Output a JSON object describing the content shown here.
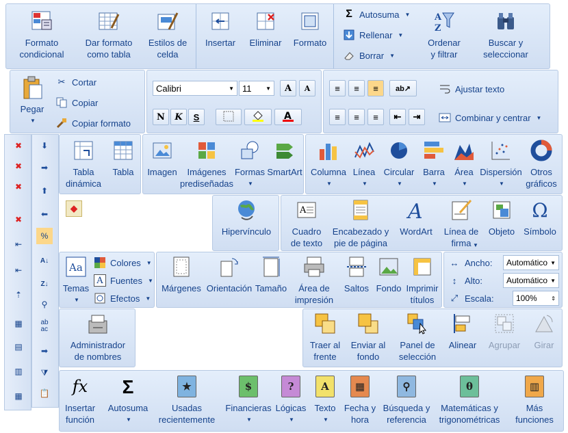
{
  "cells": {
    "formato_condicional": "Formato\ncondicional",
    "dar_formato_tabla": "Dar formato\ncomo tabla",
    "estilos_celda": "Estilos de\ncelda",
    "insertar": "Insertar",
    "eliminar": "Eliminar",
    "formato": "Formato",
    "autosuma": "Autosuma",
    "rellenar": "Rellenar",
    "borrar": "Borrar",
    "ordenar": "Ordenar\ny filtrar",
    "buscar": "Buscar y\nseleccionar"
  },
  "clipboard": {
    "pegar": "Pegar",
    "cortar": "Cortar",
    "copiar": "Copiar",
    "copiar_formato": "Copiar formato"
  },
  "font": {
    "name": "Calibri",
    "size": "11",
    "grow": "A",
    "shrink": "A",
    "bold": "N",
    "italic": "K",
    "underline": "S"
  },
  "alignment": {
    "ajustar_texto": "Ajustar texto",
    "combinar": "Combinar y centrar"
  },
  "insert_tables": {
    "tabla_dinamica": "Tabla\ndinámica",
    "tabla": "Tabla"
  },
  "insert_illustrations": {
    "imagen": "Imagen",
    "imagenes_predisenadas": "Imágenes\nprediseñadas",
    "formas": "Formas",
    "smartart": "SmartArt"
  },
  "charts": {
    "columna": "Columna",
    "linea": "Línea",
    "circular": "Circular",
    "barra": "Barra",
    "area": "Área",
    "dispersion": "Dispersión",
    "otros": "Otros\ngráficos"
  },
  "links": {
    "hipervinculo": "Hipervínculo"
  },
  "text_group": {
    "cuadro_texto": "Cuadro\nde texto",
    "encabezado": "Encabezado y\npie de página",
    "wordart": "WordArt",
    "linea_firma": "Línea de\nfirma",
    "objeto": "Objeto",
    "simbolo": "Símbolo"
  },
  "themes": {
    "temas": "Temas",
    "colores": "Colores",
    "fuentes": "Fuentes",
    "efectos": "Efectos"
  },
  "page_setup": {
    "margenes": "Márgenes",
    "orientacion": "Orientación",
    "tamano": "Tamaño",
    "area_impresion": "Área de\nimpresión",
    "saltos": "Saltos",
    "fondo": "Fondo",
    "imprimir_titulos": "Imprimir\ntítulos"
  },
  "scale": {
    "ancho_label": "Ancho:",
    "ancho_value": "Automático",
    "alto_label": "Alto:",
    "alto_value": "Automático",
    "escala_label": "Escala:",
    "escala_value": "100%"
  },
  "names": {
    "administrador": "Administrador\nde nombres"
  },
  "arrange": {
    "traer": "Traer al\nfrente",
    "enviar": "Enviar al\nfondo",
    "panel": "Panel de\nselección",
    "alinear": "Alinear",
    "agrupar": "Agrupar",
    "girar": "Girar"
  },
  "functions": {
    "insertar_funcion": "Insertar\nfunción",
    "autosuma": "Autosuma",
    "usadas": "Usadas\nrecientemente",
    "financieras": "Financieras",
    "logicas": "Lógicas",
    "texto": "Texto",
    "fecha": "Fecha y\nhora",
    "busqueda": "Búsqueda y\nreferencia",
    "matematicas": "Matemáticas y\ntrigonométricas",
    "mas": "Más\nfunciones"
  },
  "icons": {
    "fx": "fx",
    "sigma": "Σ",
    "omega": "Ω",
    "abc": "ab\nac",
    "symbol_a": "A",
    "question": "?",
    "theta": "θ"
  }
}
